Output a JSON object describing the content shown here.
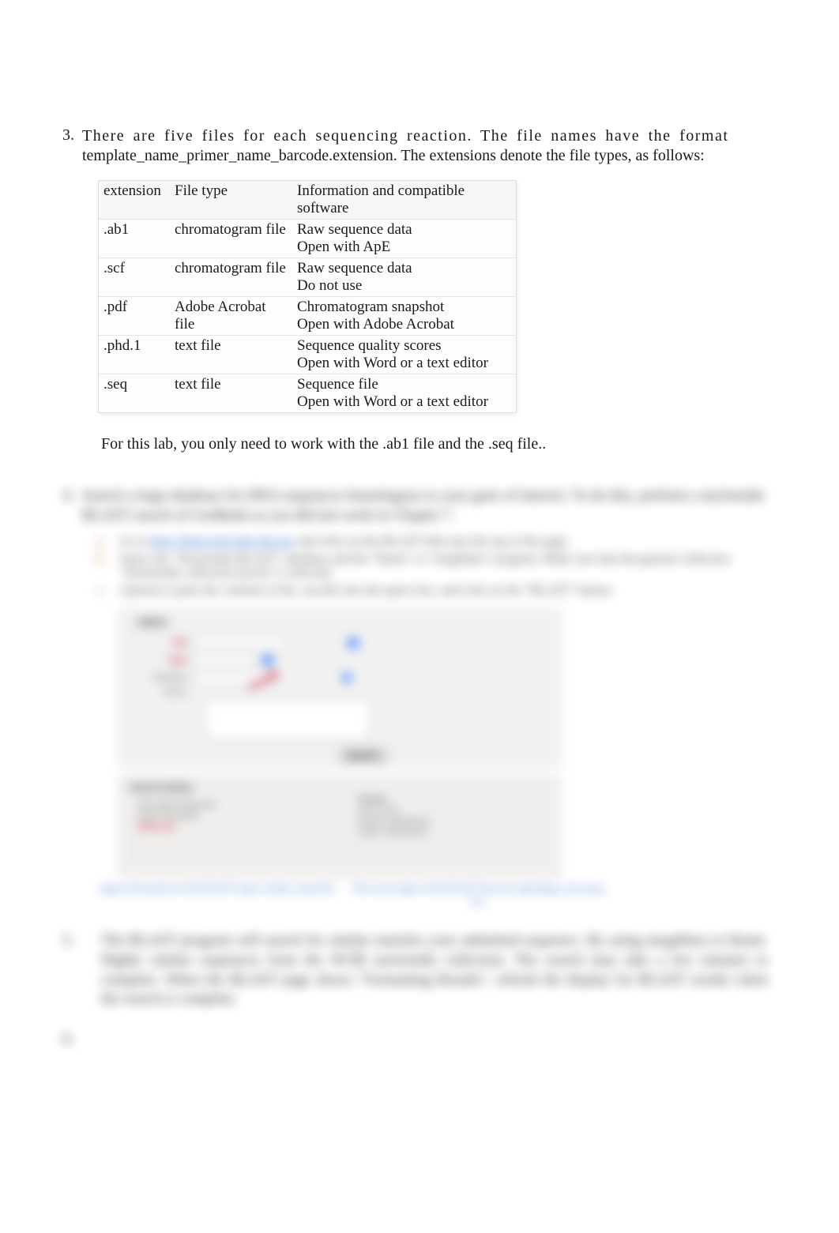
{
  "item3": {
    "number": "3.",
    "intro_line1": "There are five files for each sequencing reaction. The file names have the format",
    "intro_line2": "template_name_primer_name_barcode.extension. The extensions denote the file types, as follows:"
  },
  "table": {
    "headers": {
      "ext": "extension",
      "ftype": "File type",
      "info": "Information and compatible software"
    },
    "rows": [
      {
        "ext": ".ab1",
        "ftype": "chromatogram file",
        "info1": "Raw sequence data",
        "info2": "Open with ApE"
      },
      {
        "ext": ".scf",
        "ftype": "chromatogram file",
        "info1": "Raw sequence data",
        "info2": "Do not use"
      },
      {
        "ext": ".pdf",
        "ftype": "Adobe Acrobat file",
        "info1": "Chromatogram snapshot",
        "info2": "Open with Adobe Acrobat"
      },
      {
        "ext": ".phd.1",
        "ftype": "text file",
        "info1": "Sequence quality scores",
        "info2": "Open with Word or a text editor"
      },
      {
        "ext": ".seq",
        "ftype": "text file",
        "info1": "Sequence file",
        "info2": "Open with Word or a text editor"
      }
    ]
  },
  "after_table": "For this lab, you only need to work with the .ab1 file and the .seq file..",
  "blurred": {
    "item4_num": "4.",
    "item4_text": "Search a large database for DNA sequences homologous to your gene of interest. To do this, perform a nucleotide BLAST search of GenBank as you did last week in Chapter 7.",
    "sub_a_lbl": "a.",
    "sub_a_txt_pre": "Go to ",
    "sub_a_link": "http://blast.ncbi.nlm.nih.gov",
    "sub_a_txt_post": " and click on the BLAST link near the top of the page.",
    "sub_b_lbl": "b.",
    "sub_b_txt": "Select the \"Nucleotide BLAST\" database and the \"blastn\" or \"megablast\" program. Make sure that the general collection \"Nucleotide collection (nr/nt)\" is selected.",
    "sub_c_lbl": "c.",
    "sub_c_txt": "Upload or paste the contents of the .seq file into the query box, and click on the \"BLAST\" button.",
    "shot1": {
      "hdr": "blastn",
      "file_lbl": "File",
      "type_lbl": "Type",
      "template_lbl": "Template",
      "query_lbl": "Query",
      "file_val": "sequence.seq",
      "blast_btn": "BLAST"
    },
    "shot2": {
      "title": "Search settings",
      "p1": "Max target sequences",
      "p2": "Expect threshold",
      "p3": "Word size",
      "right_lbl": "Results",
      "hit1": "gene: locus",
      "hit2": "protein: hypothetical",
      "hit3": "strain: chromosome"
    },
    "cap_left": "Upper-left portion of the BLAST input window (step 4b).",
    "cap_right": "The lower-right of the BLAST form for uploading a file (step 4c).",
    "item5_num": "5.",
    "item5_text": "The BLAST program will search for similar matches your submitted sequence. By using megablast or blastn. Highly similar sequences from the NCBI nucleotide collection. The search may take a few minutes to complete. When the BLAST page shows \"Formatting Results\", refresh the display for BLAST results when the search is complete.",
    "item6_num": "6."
  }
}
